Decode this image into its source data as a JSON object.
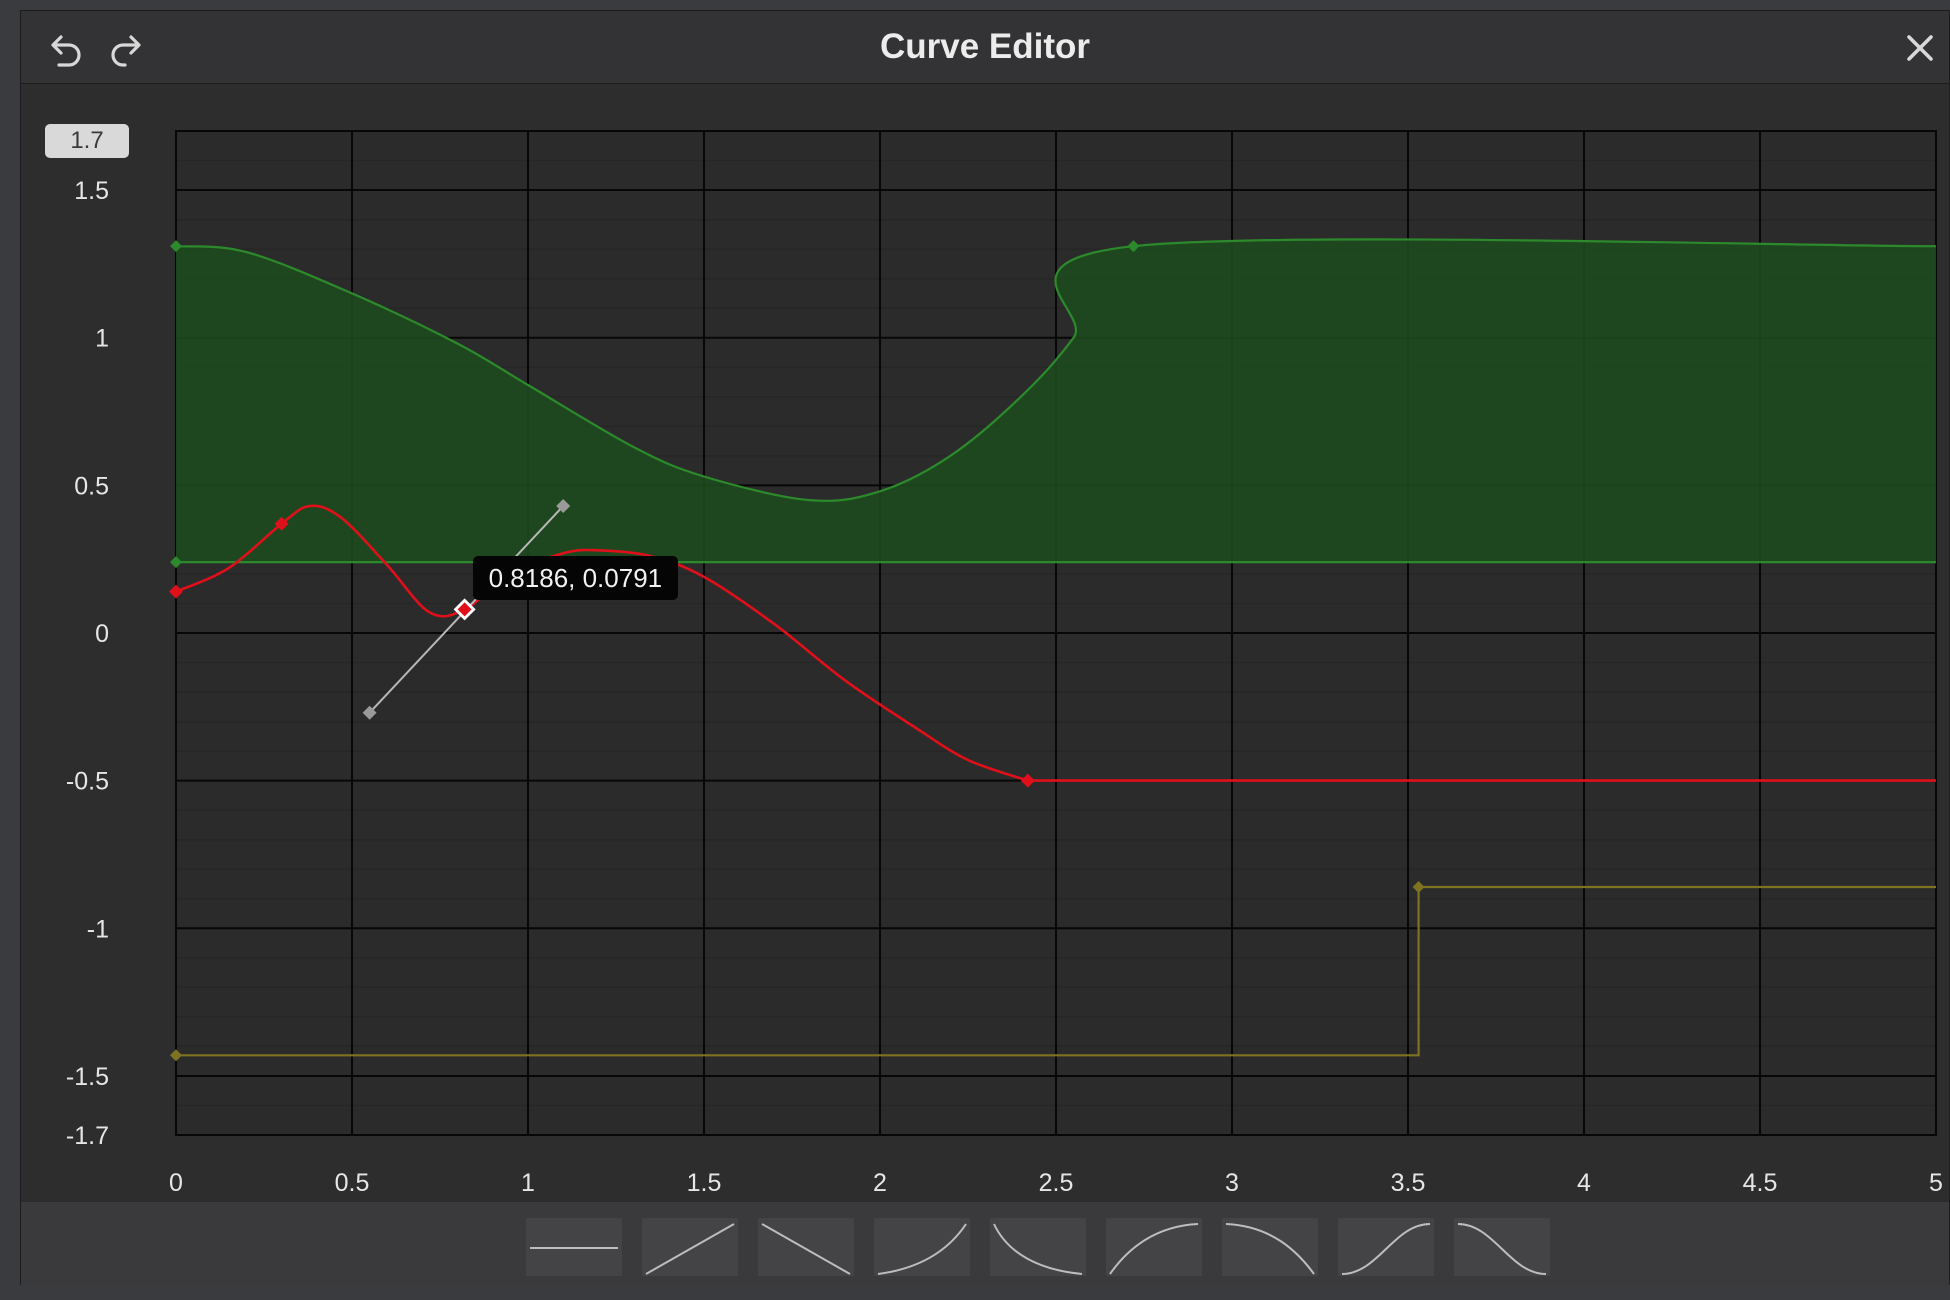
{
  "window": {
    "title": "Curve Editor",
    "undo_icon": "undo-icon",
    "redo_icon": "redo-icon",
    "close_icon": "close-icon"
  },
  "y_max_field": "1.7",
  "tooltip": "0.8186, 0.0791",
  "colors": {
    "background": "#2d2d2e",
    "grid_major": "#070707",
    "grid_minor": "#262626",
    "green_curve": "#2c8a2c",
    "green_fill": "#1e4a1e",
    "red_curve": "#e0101a",
    "yellow_curve": "#7e7320",
    "tangent": "#b8b8b8"
  },
  "chart_data": {
    "type": "line",
    "xlim": [
      0,
      5
    ],
    "ylim": [
      -1.7,
      1.7
    ],
    "x_ticks": [
      "0",
      "0.5",
      "1",
      "1.5",
      "2",
      "2.5",
      "3",
      "3.5",
      "4",
      "4.5",
      "5"
    ],
    "y_ticks": [
      "1.5",
      "1",
      "0.5",
      "0",
      "-0.5",
      "-1",
      "-1.5",
      "-1.7"
    ],
    "grid": true,
    "series": [
      {
        "color": "green",
        "kind": "range",
        "upper": {
          "keys": [
            [
              0,
              1.31
            ],
            [
              2.72,
              1.31
            ]
          ],
          "curve": [
            [
              0,
              1.31
            ],
            [
              0.2,
              1.29
            ],
            [
              0.5,
              1.15
            ],
            [
              0.8,
              0.98
            ],
            [
              1.0,
              0.84
            ],
            [
              1.3,
              0.63
            ],
            [
              1.5,
              0.53
            ],
            [
              1.8,
              0.45
            ],
            [
              2.0,
              0.48
            ],
            [
              2.2,
              0.6
            ],
            [
              2.4,
              0.8
            ],
            [
              2.55,
              1.0
            ],
            [
              2.72,
              1.31
            ],
            [
              5,
              1.31
            ]
          ]
        },
        "lower": {
          "keys": [
            [
              0,
              0.24
            ]
          ],
          "curve": [
            [
              0,
              0.24
            ],
            [
              5,
              0.24
            ]
          ]
        }
      },
      {
        "color": "red",
        "kind": "curve",
        "keys": [
          [
            0,
            0.14
          ],
          [
            0.3,
            0.37
          ],
          [
            0.82,
            0.08
          ],
          [
            2.42,
            -0.5
          ]
        ],
        "selected_key": [
          0.82,
          0.08
        ],
        "tangent_handles": [
          [
            0.55,
            -0.27
          ],
          [
            1.1,
            0.43
          ]
        ],
        "curve": [
          [
            0,
            0.14
          ],
          [
            0.15,
            0.22
          ],
          [
            0.3,
            0.37
          ],
          [
            0.38,
            0.43
          ],
          [
            0.47,
            0.39
          ],
          [
            0.6,
            0.23
          ],
          [
            0.72,
            0.07
          ],
          [
            0.82,
            0.08
          ],
          [
            0.95,
            0.2
          ],
          [
            1.1,
            0.27
          ],
          [
            1.2,
            0.28
          ],
          [
            1.35,
            0.26
          ],
          [
            1.5,
            0.19
          ],
          [
            1.7,
            0.03
          ],
          [
            1.9,
            -0.16
          ],
          [
            2.1,
            -0.32
          ],
          [
            2.25,
            -0.43
          ],
          [
            2.42,
            -0.5
          ],
          [
            5,
            -0.5
          ]
        ]
      },
      {
        "color": "yellow",
        "kind": "step",
        "keys": [
          [
            0,
            -1.43
          ],
          [
            3.53,
            -0.86
          ]
        ],
        "curve": [
          [
            0,
            -1.43
          ],
          [
            3.53,
            -1.43
          ],
          [
            3.53,
            -0.86
          ],
          [
            5,
            -0.86
          ]
        ]
      }
    ]
  },
  "presets": [
    {
      "name": "preset-constant"
    },
    {
      "name": "preset-linear-up"
    },
    {
      "name": "preset-linear-down"
    },
    {
      "name": "preset-ease-in-up"
    },
    {
      "name": "preset-ease-in-down"
    },
    {
      "name": "preset-ease-out-up"
    },
    {
      "name": "preset-ease-out-down"
    },
    {
      "name": "preset-ease-in-out-up"
    },
    {
      "name": "preset-ease-in-out-down"
    }
  ]
}
